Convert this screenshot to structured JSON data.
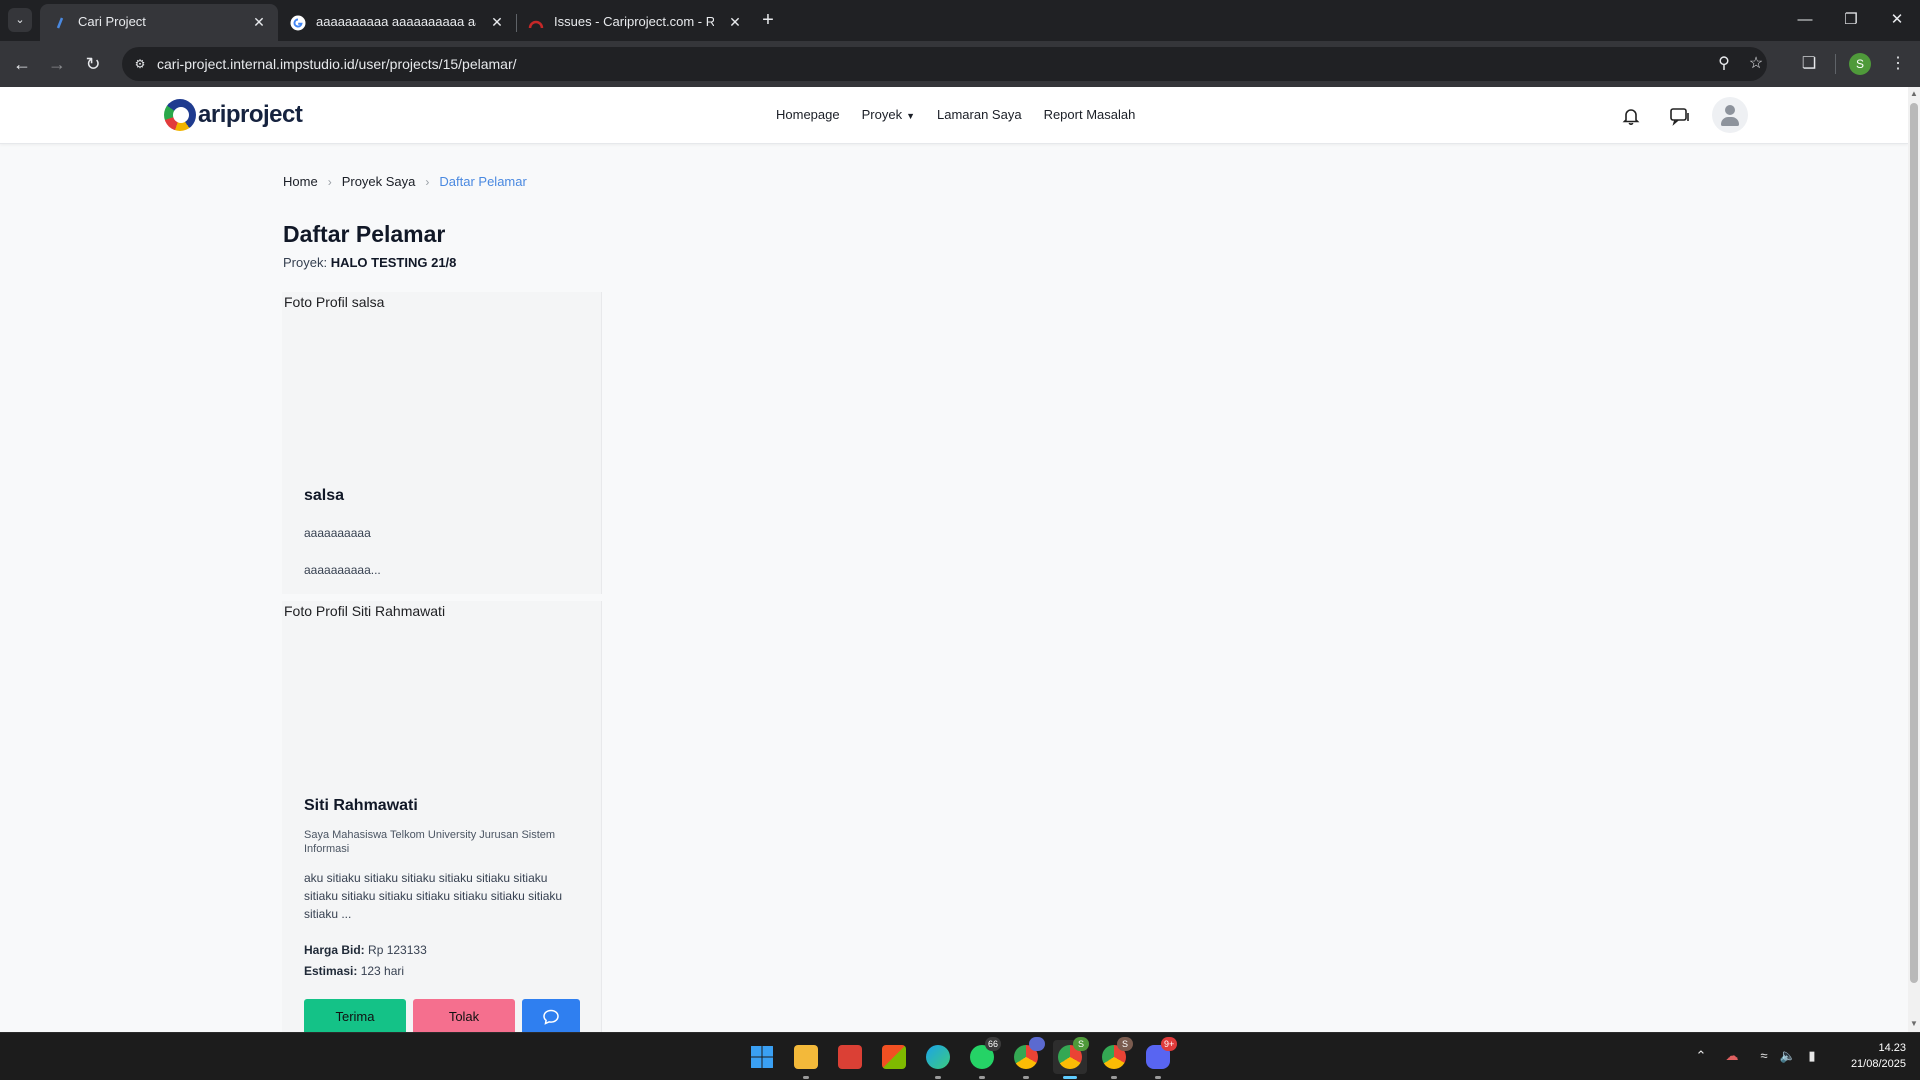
{
  "browser": {
    "tabs": [
      {
        "title": "Cari Project",
        "active": true
      },
      {
        "title": "aaaaaaaaaa aaaaaaaaaa aaaaa",
        "active": false
      },
      {
        "title": "Issues - Cariproject.com - Redm",
        "active": false
      }
    ],
    "url": "cari-project.internal.impstudio.id/user/projects/15/pelamar/",
    "profile_initial": "S"
  },
  "header": {
    "logo_text": "ariproject",
    "nav": [
      {
        "label": "Homepage"
      },
      {
        "label": "Proyek"
      },
      {
        "label": "Lamaran Saya"
      },
      {
        "label": "Report Masalah"
      }
    ]
  },
  "breadcrumb": [
    {
      "label": "Home"
    },
    {
      "label": "Proyek Saya"
    },
    {
      "label": "Daftar Pelamar"
    }
  ],
  "page": {
    "title": "Daftar Pelamar",
    "project_label": "Proyek:",
    "project_name": "HALO TESTING 21/8"
  },
  "applicants": [
    {
      "photo_alt": "Foto Profil salsa",
      "name": "salsa",
      "headline": "aaaaaaaaaa",
      "description": "aaaaaaaaaa..."
    },
    {
      "photo_alt": "Foto Profil Siti Rahmawati",
      "name": "Siti Rahmawati",
      "headline": "Saya Mahasiswa Telkom University Jurusan Sistem Informasi",
      "description": "aku sitiaku sitiaku sitiaku sitiaku sitiaku sitiaku sitiaku sitiaku sitiaku sitiaku sitiaku sitiaku sitiaku sitiaku ...",
      "bid_label": "Harga Bid:",
      "bid_value": "Rp 123133",
      "estimate_label": "Estimasi:",
      "estimate_value": "123 hari",
      "accept_label": "Terima",
      "reject_label": "Tolak"
    }
  ],
  "taskbar": {
    "badges": {
      "whatsapp": "66",
      "chrome_profile_1": "S",
      "chrome_profile_2": "S",
      "discord": "9+"
    },
    "time": "14.23",
    "date": "21/08/2025"
  },
  "colors": {
    "accept": "#14c287",
    "reject": "#f56f8e",
    "chat": "#2f7ff0",
    "breadcrumb_active": "#4a89e0"
  }
}
